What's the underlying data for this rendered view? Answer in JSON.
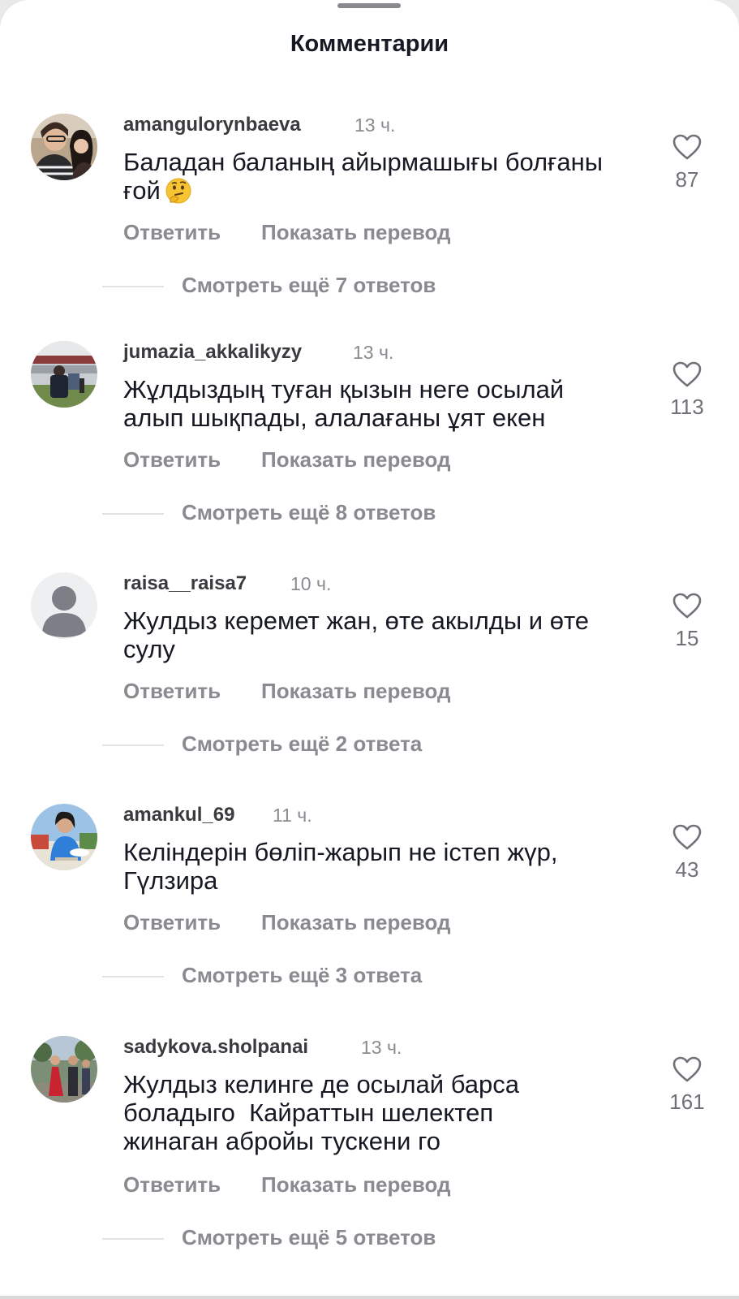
{
  "sheet": {
    "title": "Комментарии"
  },
  "labels": {
    "reply": "Ответить",
    "translate": "Показать перевод"
  },
  "colors": {
    "text_primary": "#161823",
    "text_secondary": "#8a8b91",
    "background": "#ffffff"
  },
  "comments": [
    {
      "username": "amangulorynbaeva",
      "time": "13 ч.",
      "text": "Баладан баланың айырмашығы болғаны ғой",
      "emoji": "thinking-face",
      "likes": "87",
      "more_replies": "Смотреть ещё 7 ответов"
    },
    {
      "username": "jumazia_akkalikyzy",
      "time": "13 ч.",
      "text": "Жұлдыздың туған қызын неге осылай алып шықпады, алалағаны ұят екен",
      "likes": "113",
      "more_replies": "Смотреть ещё 8 ответов"
    },
    {
      "username": "raisa__raisa7",
      "time": "10 ч.",
      "text": "Жулдыз керемет жан, өте акылды и өте сулу",
      "likes": "15",
      "more_replies": "Смотреть ещё 2 ответа"
    },
    {
      "username": "amankul_69",
      "time": "11 ч.",
      "text": "Келіндерін бөліп-жарып не істеп жүр, Гүлзира",
      "likes": "43",
      "more_replies": "Смотреть ещё 3 ответа"
    },
    {
      "username": "sadykova.sholpanai",
      "time": "13 ч.",
      "text": "Жулдыз келинге де осылай барса боладыго  Кайраттын шелектеп жинаган абройы тускени го",
      "likes": "161",
      "more_replies": "Смотреть ещё 5 ответов"
    }
  ]
}
